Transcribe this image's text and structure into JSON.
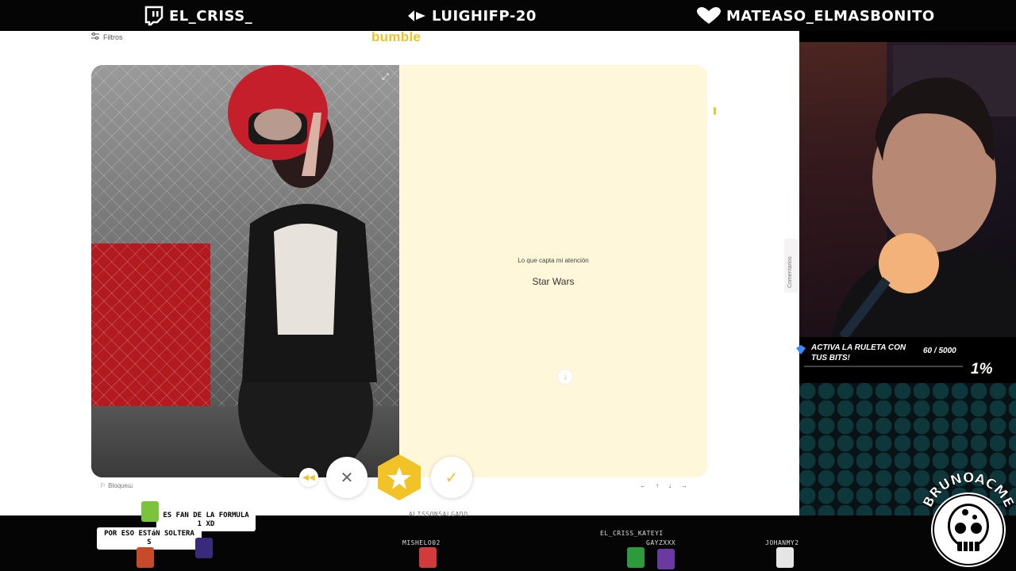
{
  "top_bar": {
    "handles": [
      {
        "icon": "twitch-icon",
        "name": "EL_CRISS_"
      },
      {
        "icon": "tiktok-icon",
        "name": "LUIGHIFP-20"
      },
      {
        "icon": "heart-icon",
        "name": "MATEASO_ELMASBONITO"
      }
    ]
  },
  "bumble": {
    "filters_label": "Filtros",
    "logo": "bumble",
    "prompt_label": "Lo que capta mi atención",
    "prompt_value": "Star Wars",
    "side_tab": "Comentarios",
    "block_label": "Bloquear",
    "nav_keys": [
      "←",
      "↑",
      "↓",
      "→"
    ],
    "accent": "#f2c326",
    "card_bg": "#fff7d9"
  },
  "bits": {
    "text": "ACTIVA LA RULETA CON TUS BITS!",
    "count": "60 / 5000",
    "percent": "1%"
  },
  "chat": {
    "bubble1": "ES FAN DE LA FORMULA 1 XD",
    "bubble2": "POR ESO ESTáN SOLTERA S",
    "user_top": "BRUNOACME",
    "users": [
      "MISHELO02",
      "EL_CRISS_KATEYI",
      "GAYZXXX",
      "JOHANMY2"
    ],
    "center_label": "ALISSONSALGADO"
  },
  "brand": "BRUNOACME"
}
